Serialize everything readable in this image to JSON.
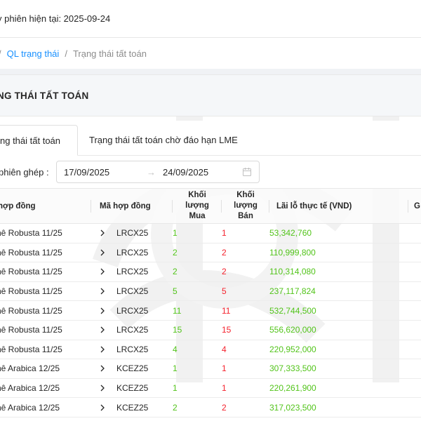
{
  "session": {
    "text": "y phiên hiện tại: 2025-09-24"
  },
  "breadcrumb": {
    "link": "QL trạng thái",
    "current": "Trạng thái tất toán",
    "separator": "/"
  },
  "page": {
    "title": "NG THÁI TẤT TOÁN"
  },
  "tabs": [
    {
      "label": "ng thái tất toán",
      "active": true
    },
    {
      "label": "Trạng thái tất toán chờ đáo hạn LME",
      "active": false
    }
  ],
  "filter": {
    "label": "phiên ghép :",
    "start": "17/09/2025",
    "arrow": "→",
    "end": "24/09/2025"
  },
  "table": {
    "headers": {
      "name": "hợp đồng",
      "code": "Mã hợp đồng",
      "buy": [
        "Khối",
        "lượng",
        "Mua"
      ],
      "sell": [
        "Khối",
        "lượng",
        "Bán"
      ],
      "pl": "Lãi lỗ thực tế (VND)",
      "extra": "G"
    },
    "rows": [
      {
        "name": "hê Robusta 11/25",
        "code": "LRCX25",
        "buy": "1",
        "sell": "1",
        "pl": "53,342,760"
      },
      {
        "name": "hê Robusta 11/25",
        "code": "LRCX25",
        "buy": "2",
        "sell": "2",
        "pl": "110,999,800"
      },
      {
        "name": "hê Robusta 11/25",
        "code": "LRCX25",
        "buy": "2",
        "sell": "2",
        "pl": "110,314,080"
      },
      {
        "name": "hê Robusta 11/25",
        "code": "LRCX25",
        "buy": "5",
        "sell": "5",
        "pl": "237,117,824"
      },
      {
        "name": "hê Robusta 11/25",
        "code": "LRCX25",
        "buy": "11",
        "sell": "11",
        "pl": "532,744,500"
      },
      {
        "name": "hê Robusta 11/25",
        "code": "LRCX25",
        "buy": "15",
        "sell": "15",
        "pl": "556,620,000"
      },
      {
        "name": "hê Robusta 11/25",
        "code": "LRCX25",
        "buy": "4",
        "sell": "4",
        "pl": "220,952,000"
      },
      {
        "name": "hê Arabica 12/25",
        "code": "KCEZ25",
        "buy": "1",
        "sell": "1",
        "pl": "307,333,500"
      },
      {
        "name": "hê Arabica 12/25",
        "code": "KCEZ25",
        "buy": "1",
        "sell": "1",
        "pl": "220,261,900"
      },
      {
        "name": "hê Arabica 12/25",
        "code": "KCEZ25",
        "buy": "2",
        "sell": "2",
        "pl": "317,023,500"
      }
    ]
  },
  "colors": {
    "link": "#1890ff",
    "buy": "#52c41a",
    "sell": "#f5222d",
    "pl": "#52c41a"
  },
  "icons": [
    "calendar-icon",
    "chevron-right-icon"
  ]
}
